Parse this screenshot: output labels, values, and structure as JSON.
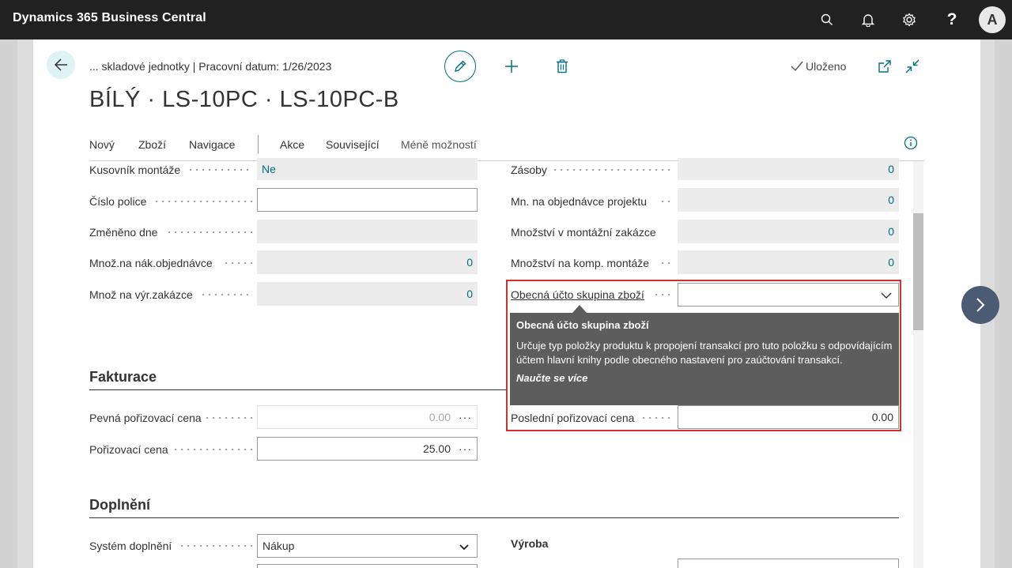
{
  "app": {
    "title": "Dynamics 365 Business Central",
    "user_initial": "A"
  },
  "header": {
    "breadcrumb": "... skladové jednotky | Pracovní datum: 1/26/2023",
    "title": "BÍLÝ · LS-10PC · LS-10PC-B",
    "saved_label": "Uloženo"
  },
  "actions": {
    "new": "Nový",
    "item": "Zboží",
    "navigate": "Navigace",
    "actions": "Akce",
    "related": "Související",
    "fewer": "Méně možností"
  },
  "left_fields": [
    {
      "label": "Kusovník montáže",
      "value": "Ne"
    },
    {
      "label": "Číslo police",
      "value": ""
    },
    {
      "label": "Změněno dne",
      "value": ""
    },
    {
      "label": "Množ.na nák.objednávce",
      "value": "0"
    },
    {
      "label": "Množ na výr.zakázce",
      "value": "0"
    }
  ],
  "right_fields": [
    {
      "label": "Zásoby",
      "value": "0"
    },
    {
      "label": "Mn. na objednávce projektu",
      "value": "0"
    },
    {
      "label": "Množství v montážní zakázce",
      "value": "0"
    },
    {
      "label": "Množství na komp. montáže",
      "value": "0"
    },
    {
      "label": "Obecná účto skupina zboží",
      "value": ""
    }
  ],
  "tooltip": {
    "title": "Obecná účto skupina zboží",
    "body": "Určuje typ položky produktu k propojení transakcí pro tuto položku s odpovídajícím účtem hlavní knihy podle obecného nastavení pro zaúčtování transakcí.",
    "link": "Naučte se více"
  },
  "invoicing": {
    "title": "Fakturace",
    "fixed_cost_label": "Pevná pořizovací cena",
    "fixed_cost_value": "0.00",
    "unit_cost_label": "Pořizovací cena",
    "unit_cost_value": "25.00",
    "last_cost_label": "Poslední pořizovací cena",
    "last_cost_value": "0.00"
  },
  "replenishment": {
    "title": "Doplnění",
    "system_label": "Systém doplnění",
    "system_value": "Nákup",
    "production_heading": "Výroba"
  }
}
